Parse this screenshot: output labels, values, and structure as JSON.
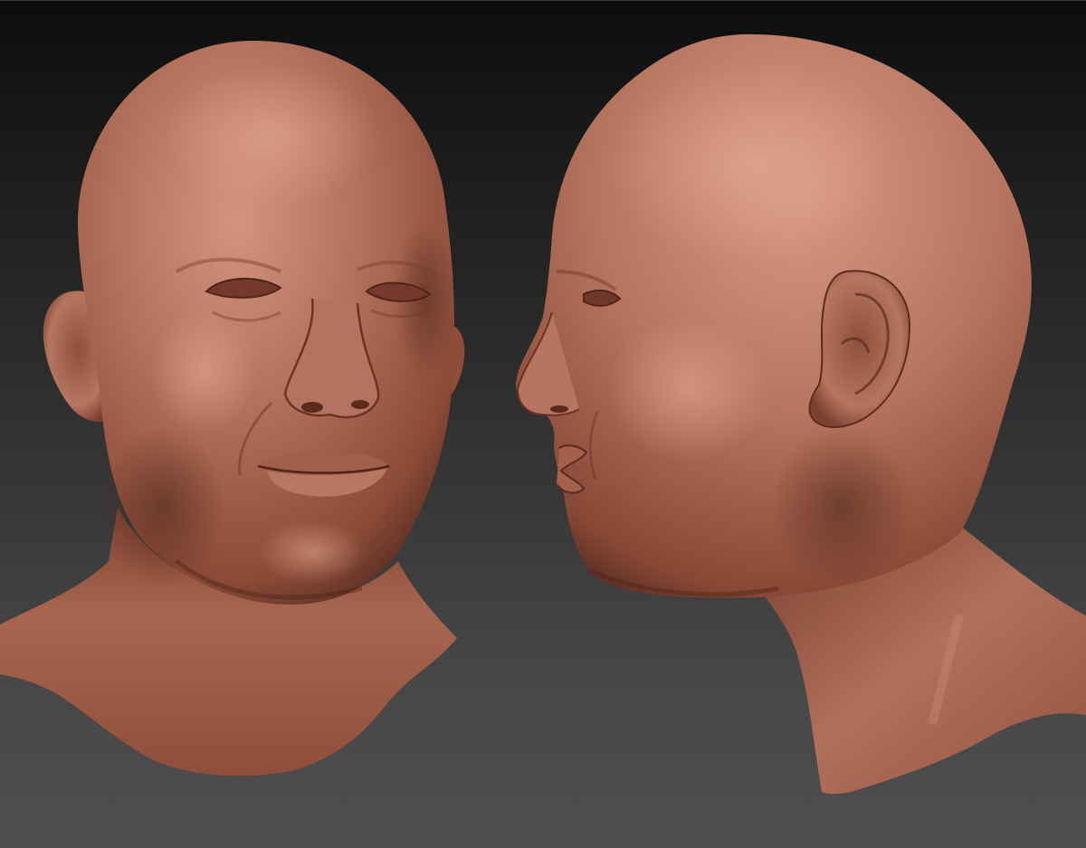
{
  "scene": {
    "description_label": "",
    "views": [
      {
        "name": "front-three-quarter",
        "icon": "head-front-view"
      },
      {
        "name": "side-profile",
        "icon": "head-profile-view"
      }
    ],
    "colors": {
      "background_top": "#0d0d0d",
      "background_bottom": "#4f4f4f",
      "clay_base": "#a0604c",
      "clay_light": "#cf8e78",
      "clay_shadow": "#5c2f22"
    }
  }
}
